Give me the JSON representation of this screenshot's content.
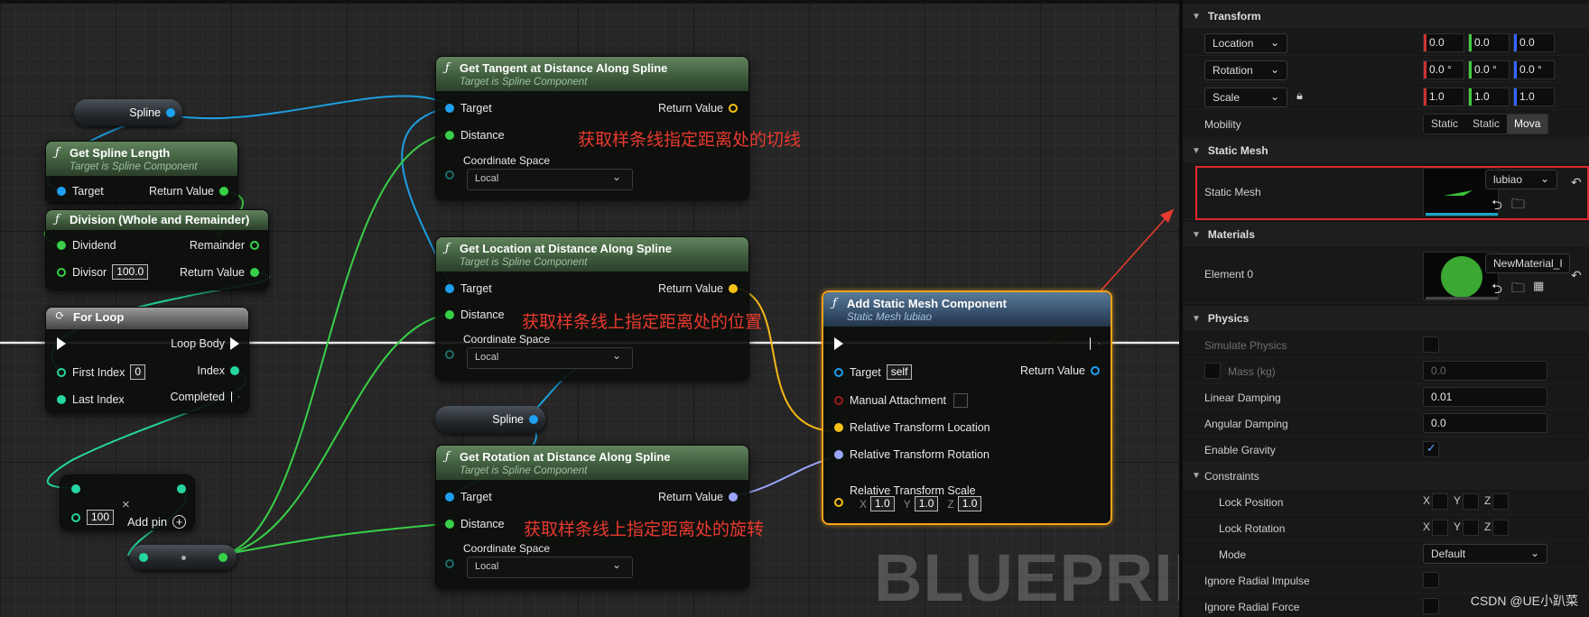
{
  "graph": {
    "watermark": "BLUEPRINT",
    "spline_var_top": {
      "label": "Spline"
    },
    "spline_var_mid": {
      "label": "Spline"
    },
    "get_spline_length": {
      "title": "Get Spline Length",
      "subtitle": "Target is Spline Component",
      "pin_target": "Target",
      "pin_return": "Return Value"
    },
    "division": {
      "title": "Division (Whole and Remainder)",
      "pin_dividend": "Dividend",
      "pin_remainder": "Remainder",
      "pin_divisor": "Divisor",
      "divisor_value": "100.0",
      "pin_return": "Return Value"
    },
    "for_loop": {
      "title": "For Loop",
      "pin_loop_body": "Loop Body",
      "pin_first_index": "First Index",
      "first_index_value": "0",
      "pin_index": "Index",
      "pin_last_index": "Last Index",
      "pin_completed": "Completed"
    },
    "multiply": {
      "value": "100",
      "add_pin": "Add pin",
      "remove_symbol": "×"
    },
    "get_tangent": {
      "title": "Get Tangent at Distance Along Spline",
      "subtitle": "Target is Spline Component",
      "pin_target": "Target",
      "pin_return": "Return Value",
      "pin_distance": "Distance",
      "pin_coord": "Coordinate Space",
      "coord_value": "Local",
      "annotation": "获取样条线指定距离处的切线"
    },
    "get_location": {
      "title": "Get Location at Distance Along Spline",
      "subtitle": "Target is Spline Component",
      "pin_target": "Target",
      "pin_return": "Return Value",
      "pin_distance": "Distance",
      "pin_coord": "Coordinate Space",
      "coord_value": "Local",
      "annotation": "获取样条线上指定距离处的位置"
    },
    "get_rotation": {
      "title": "Get Rotation at Distance Along Spline",
      "subtitle": "Target is Spline Component",
      "pin_target": "Target",
      "pin_return": "Return Value",
      "pin_distance": "Distance",
      "pin_coord": "Coordinate Space",
      "coord_value": "Local",
      "annotation": "获取样条线上指定距离处的旋转"
    },
    "add_static_mesh": {
      "title": "Add Static Mesh Component",
      "subtitle": "Static Mesh lubiao",
      "pin_target": "Target",
      "target_value": "self",
      "pin_return": "Return Value",
      "pin_manual": "Manual Attachment",
      "pin_rel_loc": "Relative Transform Location",
      "pin_rel_rot": "Relative Transform Rotation",
      "pin_rel_scale": "Relative Transform Scale",
      "scale_x_label": "X",
      "scale_x": "1.0",
      "scale_y_label": "Y",
      "scale_y": "1.0",
      "scale_z_label": "Z",
      "scale_z": "1.0"
    }
  },
  "details": {
    "transform": {
      "section": "Transform",
      "location_label": "Location",
      "location": [
        "0.0",
        "0.0",
        "0.0"
      ],
      "rotation_label": "Rotation",
      "rotation": [
        "0.0 °",
        "0.0 °",
        "0.0 °"
      ],
      "scale_label": "Scale",
      "scale": [
        "1.0",
        "1.0",
        "1.0"
      ],
      "mobility_label": "Mobility",
      "mobility_options": [
        "Static",
        "Static",
        "Mova"
      ],
      "mobility_selected": "Mova"
    },
    "static_mesh": {
      "section": "Static Mesh",
      "label": "Static Mesh",
      "value": "lubiao"
    },
    "materials": {
      "section": "Materials",
      "element_label": "Element 0",
      "value": "NewMaterial_I"
    },
    "physics": {
      "section": "Physics",
      "simulate_label": "Simulate Physics",
      "mass_label": "Mass (kg)",
      "mass_value": "0.0",
      "linear_damping_label": "Linear Damping",
      "linear_damping": "0.01",
      "angular_damping_label": "Angular Damping",
      "angular_damping": "0.0",
      "enable_gravity_label": "Enable Gravity"
    },
    "constraints": {
      "section": "Constraints",
      "lock_position_label": "Lock Position",
      "lock_rotation_label": "Lock Rotation",
      "axis_x": "X",
      "axis_y": "Y",
      "axis_z": "Z",
      "mode_label": "Mode",
      "mode_value": "Default"
    },
    "ignore_radial_impulse_label": "Ignore Radial Impulse",
    "ignore_radial_force_label": "Ignore Radial Force"
  },
  "credit": "CSDN @UE小趴菜",
  "colors": {
    "exec": "#ffffff",
    "object": "#1ea0f0",
    "float": "#38d048",
    "int": "#25d6a0",
    "vector": "#f5c215",
    "rotator": "#9aa6ff",
    "annotation": "#e83a2e",
    "selection": "#f3a21b"
  }
}
